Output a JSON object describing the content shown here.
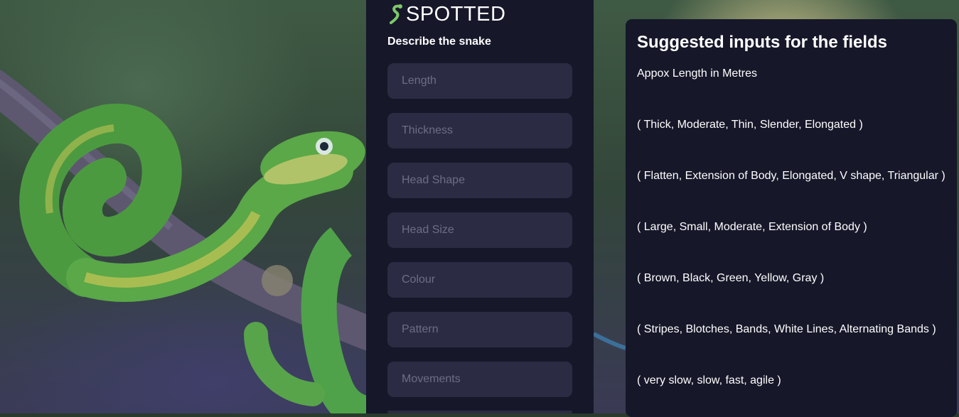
{
  "brand": {
    "name": "SPOTTED",
    "icon": "snake-logo-icon",
    "accent": "#7ec86a"
  },
  "form": {
    "title": "Describe the snake",
    "fields": [
      {
        "placeholder": "Length",
        "value": ""
      },
      {
        "placeholder": "Thickness",
        "value": ""
      },
      {
        "placeholder": "Head Shape",
        "value": ""
      },
      {
        "placeholder": "Head Size",
        "value": ""
      },
      {
        "placeholder": "Colour",
        "value": ""
      },
      {
        "placeholder": "Pattern",
        "value": ""
      },
      {
        "placeholder": "Movements",
        "value": ""
      }
    ]
  },
  "suggestions": {
    "title": "Suggested inputs for the fields",
    "lines": [
      "Appox Length in Metres",
      "( Thick, Moderate, Thin, Slender, Elongated )",
      "( Flatten, Extension of Body, Elongated, V shape, Triangular )",
      "( Large, Small, Moderate, Extension of Body )",
      "( Brown, Black, Green, Yellow, Gray )",
      "( Stripes, Blotches, Bands, White Lines, Alternating Bands )",
      "( very slow, slow, fast, agile )"
    ]
  },
  "colors": {
    "panel": "#161729",
    "field": "#2b2c44",
    "placeholder": "#6c6e86"
  }
}
